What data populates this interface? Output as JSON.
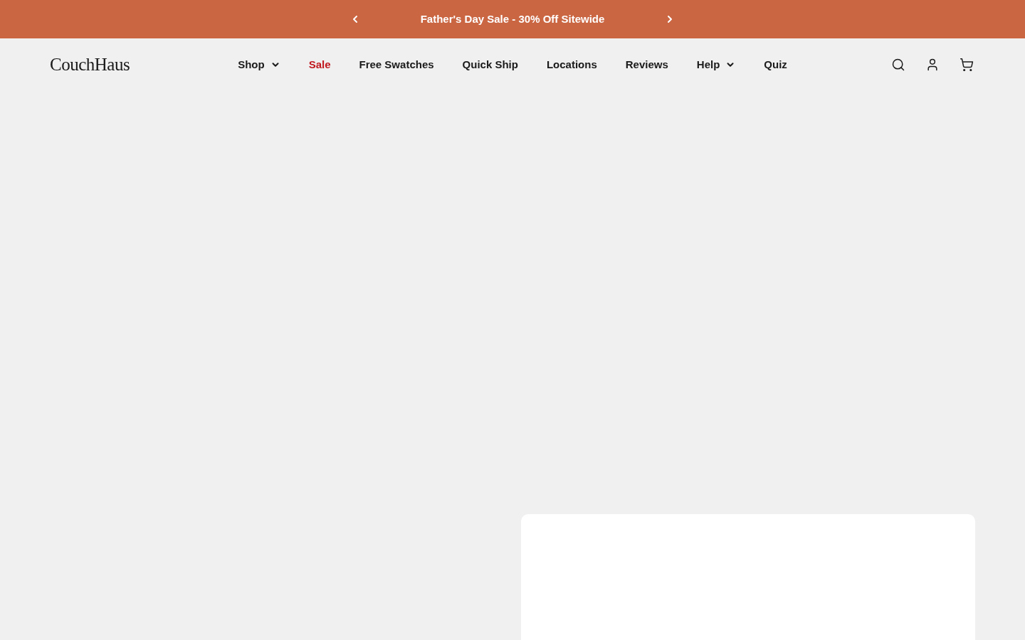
{
  "announcement": {
    "text": "Father's Day Sale - 30% Off Sitewide"
  },
  "header": {
    "logo": "CouchHaus",
    "nav": [
      {
        "label": "Shop",
        "dropdown": true,
        "highlighted": false
      },
      {
        "label": "Sale",
        "dropdown": false,
        "highlighted": true
      },
      {
        "label": "Free Swatches",
        "dropdown": false,
        "highlighted": false
      },
      {
        "label": "Quick Ship",
        "dropdown": false,
        "highlighted": false
      },
      {
        "label": "Locations",
        "dropdown": false,
        "highlighted": false
      },
      {
        "label": "Reviews",
        "dropdown": false,
        "highlighted": false
      },
      {
        "label": "Help",
        "dropdown": true,
        "highlighted": false
      },
      {
        "label": "Quiz",
        "dropdown": false,
        "highlighted": false
      }
    ]
  }
}
